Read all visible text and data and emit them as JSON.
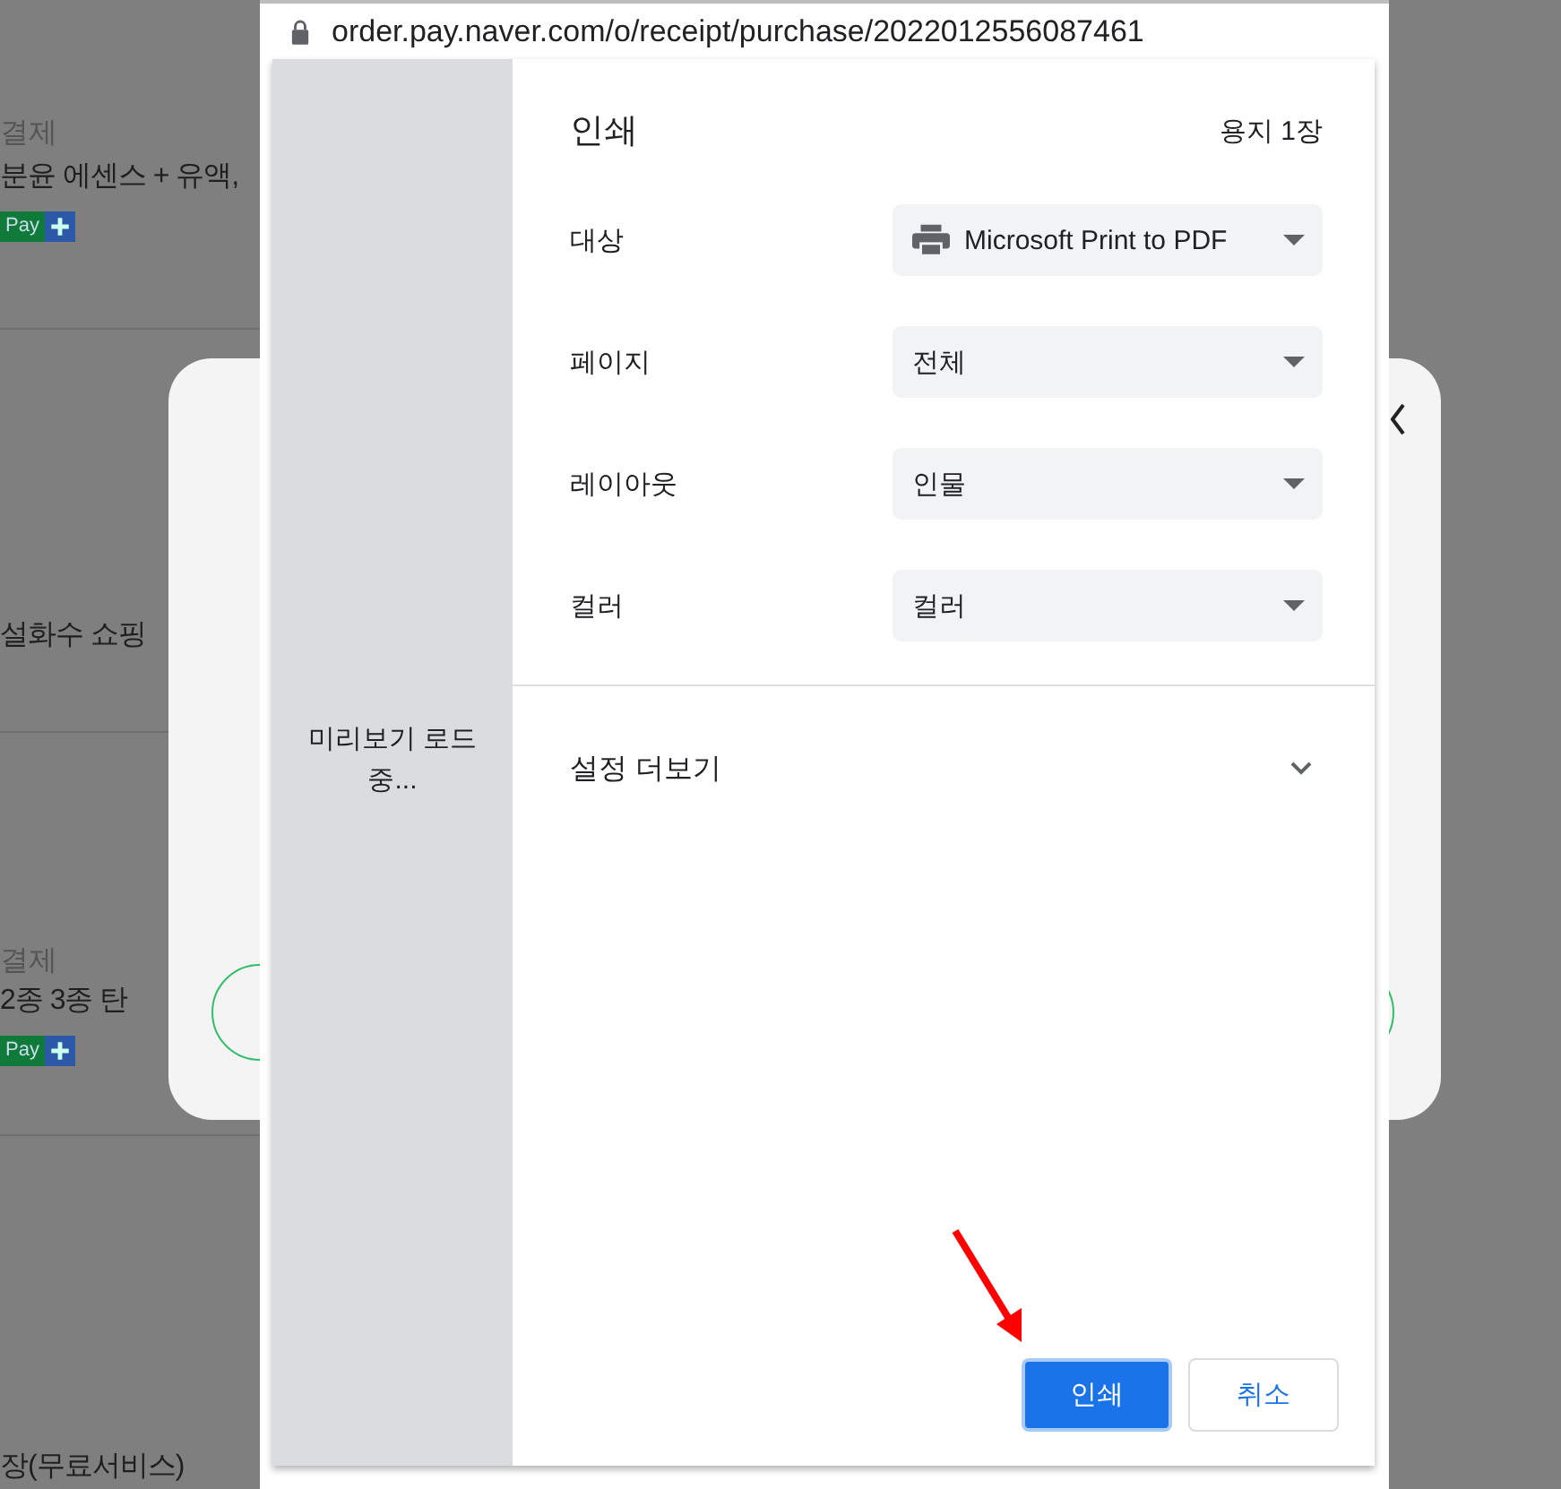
{
  "background_page": {
    "items": [
      {
        "kind": "label",
        "text": "결제"
      },
      {
        "kind": "title",
        "text": "분윤 에센스 + 유액,"
      },
      {
        "kind": "badge",
        "text": "Pay"
      },
      {
        "kind": "title",
        "text": "설화수 쇼핑"
      },
      {
        "kind": "label",
        "text": "결제"
      },
      {
        "kind": "title",
        "text": "2종 3종 탄"
      },
      {
        "kind": "badge",
        "text": "Pay"
      },
      {
        "kind": "title",
        "text": "장(무료서비스)"
      }
    ]
  },
  "browser": {
    "url": "order.pay.naver.com/o/receipt/purchase/2022012556087461"
  },
  "print_dialog": {
    "preview_status": "미리보기 로드 중...",
    "title": "인쇄",
    "sheet_count": "용지 1장",
    "settings": [
      {
        "label": "대상",
        "value": "Microsoft Print to PDF",
        "kind": "printer"
      },
      {
        "label": "페이지",
        "value": "전체",
        "kind": "plain"
      },
      {
        "label": "레이아웃",
        "value": "인물",
        "kind": "plain"
      },
      {
        "label": "컬러",
        "value": "컬러",
        "kind": "plain"
      }
    ],
    "more_settings": {
      "label": "설정 더보기",
      "expanded": false
    },
    "buttons": [
      {
        "label": "인쇄",
        "kind": "primary"
      },
      {
        "label": "취소",
        "kind": "secondary"
      }
    ]
  }
}
